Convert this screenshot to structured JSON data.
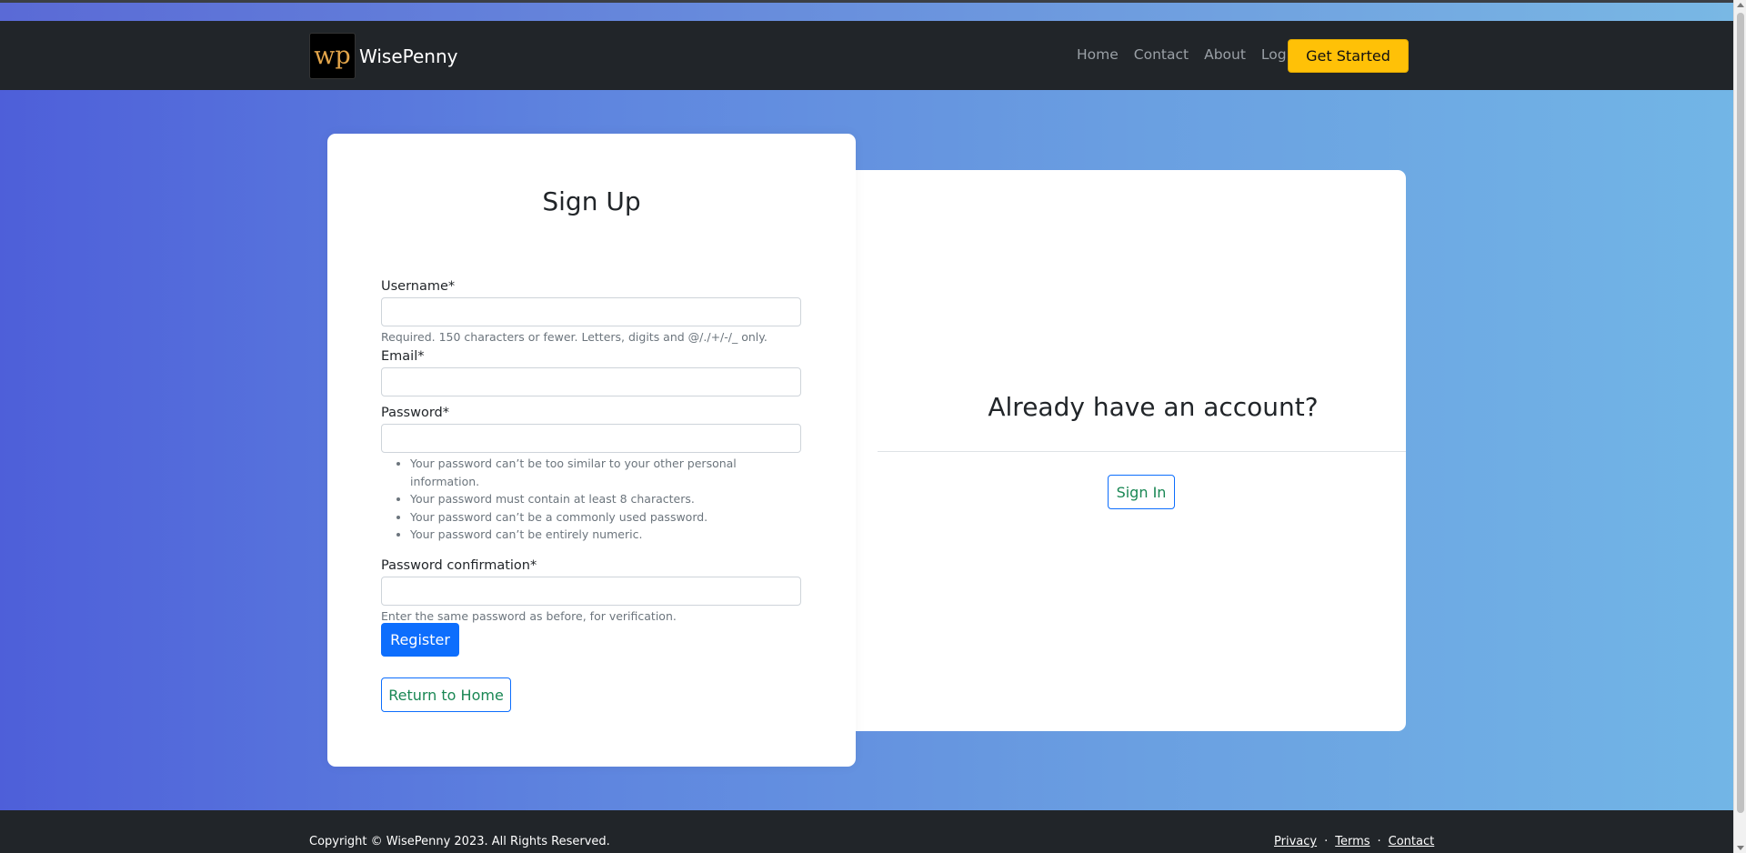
{
  "navbar": {
    "logo_text": "wp",
    "brand_name": "WisePenny",
    "links": [
      "Home",
      "Contact",
      "About",
      "Login"
    ],
    "cta_label": "Get Started"
  },
  "signup": {
    "title": "Sign Up",
    "username_label": "Username*",
    "username_value": "",
    "username_help": "Required. 150 characters or fewer. Letters, digits and @/./+/-/_ only.",
    "email_label": "Email*",
    "email_value": "",
    "password_label": "Password*",
    "password_value": "",
    "password_rules": [
      "Your password can’t be too similar to your other personal information.",
      "Your password must contain at least 8 characters.",
      "Your password can’t be a commonly used password.",
      "Your password can’t be entirely numeric."
    ],
    "confirm_label": "Password confirmation*",
    "confirm_value": "",
    "confirm_help": "Enter the same password as before, for verification.",
    "register_label": "Register",
    "return_label": "Return to Home"
  },
  "signin_panel": {
    "heading": "Already have an account?",
    "button_label": "Sign In"
  },
  "footer": {
    "copyright": "Copyright © WisePenny 2023. All Rights Reserved.",
    "links": [
      "Privacy",
      "Terms",
      "Contact"
    ],
    "separator": "·"
  },
  "colors": {
    "navbar_bg": "#212529",
    "cta_bg": "#ffc107",
    "primary": "#0d6efd",
    "success_text": "#198754"
  }
}
